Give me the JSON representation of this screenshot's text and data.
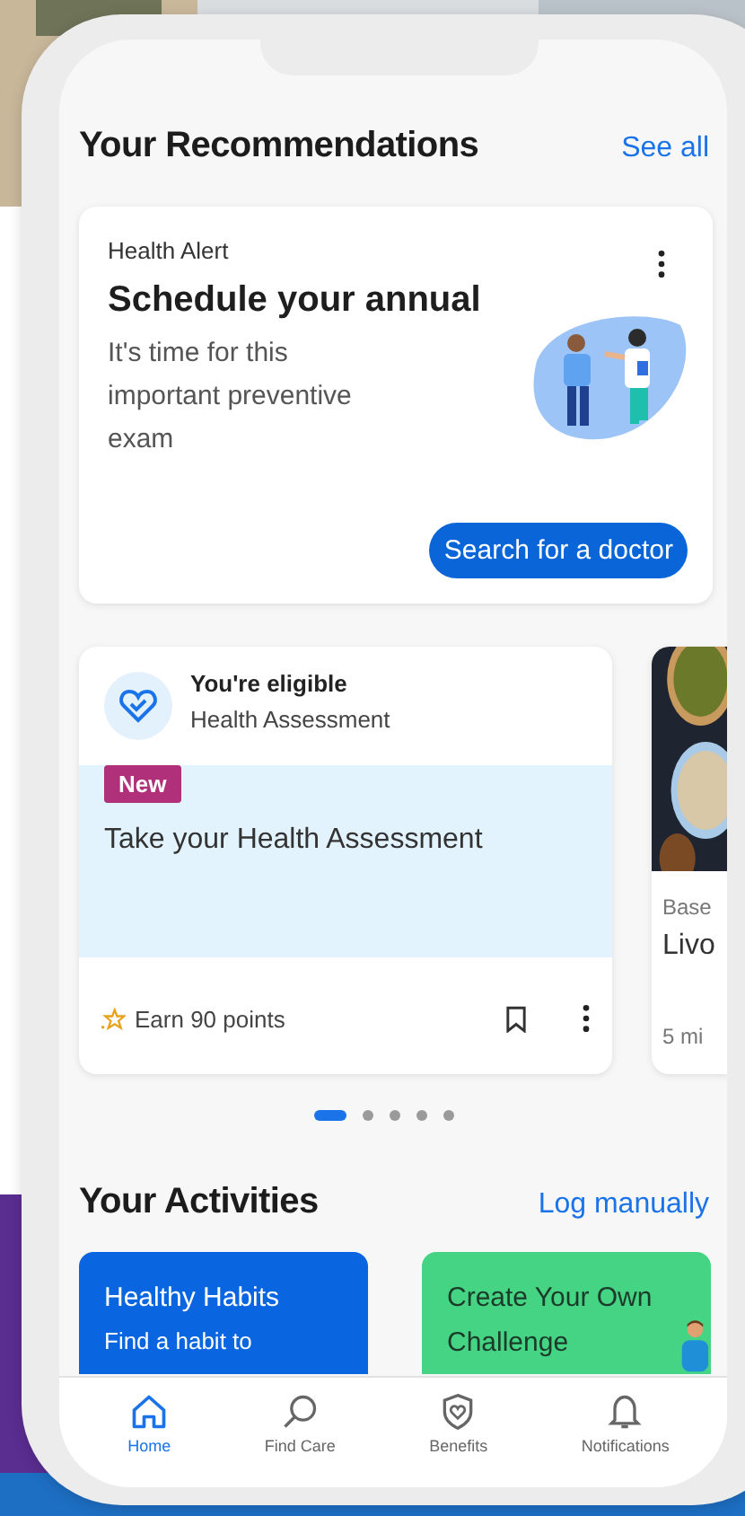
{
  "recommendations": {
    "title": "Your Recommendations",
    "link": "See all"
  },
  "alert_card": {
    "eyebrow": "Health Alert",
    "title": "Schedule your annual",
    "body": "It's time for this important preventive exam",
    "button": "Search for a doctor"
  },
  "carousel": [
    {
      "kind": "assessment",
      "status": "You're eligible",
      "subtitle": "Health Assessment",
      "badge": "New",
      "title": "Take your Health Assessment",
      "points": "Earn 90 points"
    },
    {
      "kind": "article",
      "eyebrow": "Base",
      "title": "Livo",
      "meta": "5 mi"
    }
  ],
  "pager": [
    {
      "selected": true
    },
    {
      "selected": false
    },
    {
      "selected": false
    },
    {
      "selected": false
    },
    {
      "selected": false
    }
  ],
  "activities": {
    "title": "Your Activities",
    "link": "Log manually",
    "tiles": [
      {
        "kind": "habits",
        "title": "Healthy Habits",
        "body": "Find a habit to",
        "color": "#0a66e0"
      },
      {
        "kind": "challenge",
        "title": "Create Your Own Challenge",
        "color": "#45d483"
      }
    ]
  },
  "nav": [
    {
      "label": "Home",
      "selected": true
    },
    {
      "label": "Find Care",
      "selected": false
    },
    {
      "label": "Benefits",
      "selected": false
    },
    {
      "label": "Notifications",
      "selected": false
    }
  ]
}
